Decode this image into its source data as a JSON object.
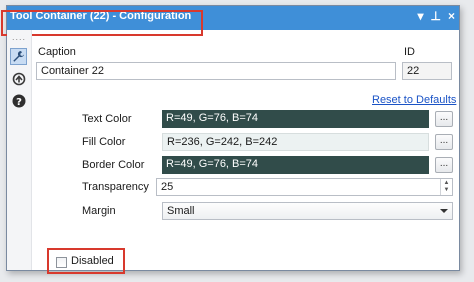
{
  "window": {
    "title": "Tool Container (22) - Configuration",
    "controls": [
      "▾",
      "⊥",
      "×"
    ]
  },
  "sidebar": {
    "grip": "....",
    "buttons": [
      {
        "icon": "wrench-icon"
      },
      {
        "icon": "connection-icon"
      },
      {
        "icon": "help-icon",
        "glyph": "?"
      }
    ]
  },
  "form": {
    "caption_label": "Caption",
    "caption_value": "Container 22",
    "id_label": "ID",
    "id_value": "22",
    "reset_link": "Reset to Defaults",
    "text_color_label": "Text Color",
    "text_color_value": "R=49, G=76, B=74",
    "fill_color_label": "Fill Color",
    "fill_color_value": "R=236, G=242, B=242",
    "border_color_label": "Border Color",
    "border_color_value": "R=49, G=76, B=74",
    "browse_label": "...",
    "transparency_label": "Transparency",
    "transparency_value": "25",
    "margin_label": "Margin",
    "margin_value": "Small",
    "disabled_label": "Disabled",
    "disabled_checked": false
  },
  "colors": {
    "title_bar": "#3f8fd8",
    "text_color": "#314c4a",
    "fill_color": "#ecf2f2",
    "border_color": "#314c4a",
    "highlight": "#d8392d"
  }
}
